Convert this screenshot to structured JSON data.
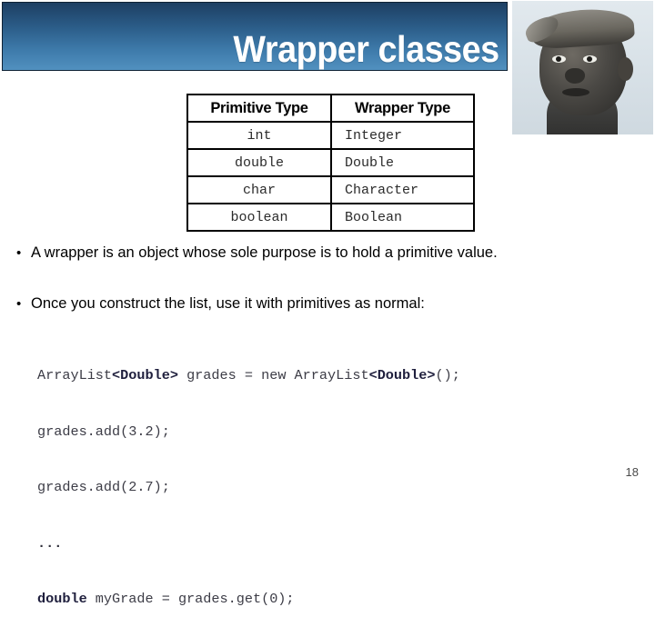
{
  "slide": {
    "title": "Wrapper classes",
    "page_number": "18",
    "header_gradient_top": "#1d3f63",
    "header_gradient_bottom": "#5190bf"
  },
  "photo": {
    "alt": "portrait-photo"
  },
  "table": {
    "headers": [
      "Primitive Type",
      "Wrapper Type"
    ],
    "rows": [
      {
        "primitive": "int",
        "wrapper": "Integer"
      },
      {
        "primitive": "double",
        "wrapper": "Double"
      },
      {
        "primitive": "char",
        "wrapper": "Character"
      },
      {
        "primitive": "boolean",
        "wrapper": "Boolean"
      }
    ]
  },
  "bullets": [
    {
      "marker": "•",
      "text": "A wrapper is an object whose sole purpose is to hold a primitive value."
    },
    {
      "marker": "•",
      "text": "Once you construct the list, use it with primitives as normal:"
    }
  ],
  "code": {
    "line1_a": "ArrayList",
    "line1_kw1": "<Double>",
    "line1_b": " grades = new ArrayList",
    "line1_kw2": "<Double>",
    "line1_c": "();",
    "line2": "grades.add(3.2);",
    "line3": "grades.add(2.7);",
    "line4": "...",
    "line5_kw": "double",
    "line5_rest": " myGrade = grades.get(0);"
  }
}
